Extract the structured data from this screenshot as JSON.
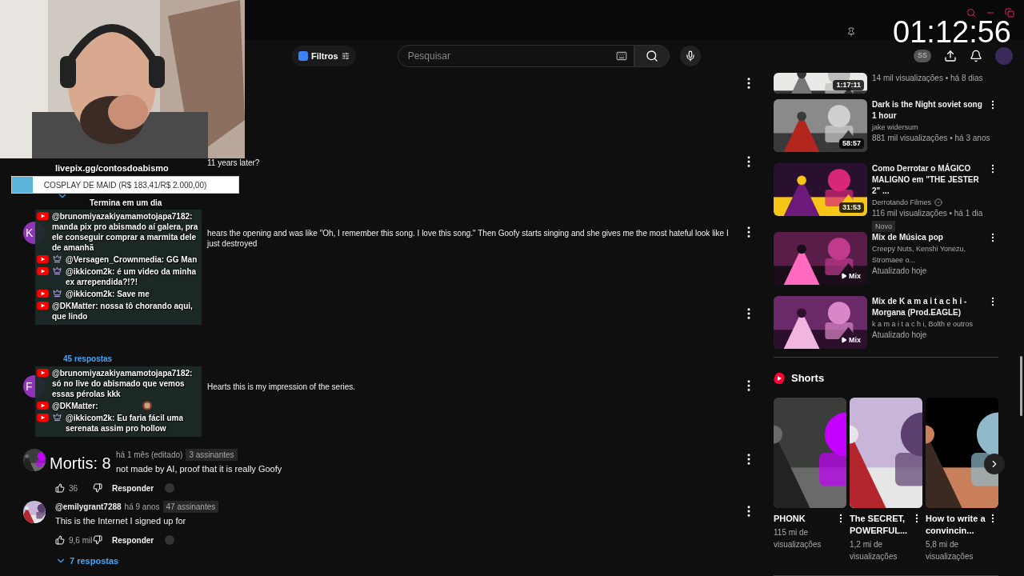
{
  "header": {
    "filter_chip": "Filtros",
    "search": {
      "placeholder": "Pesquisar"
    },
    "account_chip": "SS"
  },
  "comments": [
    {
      "kind": "covered"
    },
    {
      "kind": "partial",
      "text": "11 years later?",
      "replies_toggle": true
    },
    {
      "kind": "partial",
      "avatar_letter": "K",
      "text": "hears the opening and was like \"Oh, I remember this song. I love this song.\" Then Goofy starts singing and she gives me the most hateful look like I just destroyed"
    },
    {
      "kind": "covered",
      "replies": "45 respostas"
    },
    {
      "kind": "partial",
      "avatar_letter": "F",
      "text": "Hearts this is my impression of the series."
    },
    {
      "kind": "full",
      "time": "há 1 mês (editado)",
      "subscribers": "3 assinantes",
      "text": "not made by AI, proof that it is really Goofy",
      "likes": "36",
      "reply": "Responder"
    },
    {
      "kind": "full",
      "author": "@emilygrant7288",
      "time": "há 9 anos",
      "subscribers": "47 assinantes",
      "text": "This is the Internet I signed up for",
      "likes": "9,6 mil",
      "reply": "Responder",
      "replies": "7 respostas"
    }
  ],
  "sidebar": {
    "videos": [
      {
        "kind": "partial",
        "meta": "14 mil visualizações • há 8 dias",
        "duration": "1:17:11"
      },
      {
        "kind": "video",
        "title": "Dark is the Night soviet song 1 hour",
        "channel": "jake widersum",
        "verified": false,
        "meta": "881 mil visualizações • há 3 anos",
        "duration": "58:57"
      },
      {
        "kind": "video",
        "title": "Como Derrotar o MÁGICO MALIGNO em \"THE JESTER 2\" ...",
        "channel": "Derrotando Filmes",
        "verified": true,
        "meta": "116 mil visualizações • há 1 dia",
        "badge": "Novo",
        "duration": "31:53"
      },
      {
        "kind": "mix",
        "title": "Mix de Música pop",
        "channel": "Creepy Nuts, Kenshi Yonezu, Stromaee o...",
        "meta": "Atualizado hoje",
        "mix_label": "Mix"
      },
      {
        "kind": "mix",
        "title": "Mix de K a m a i t a c h i - Morgana (Prod.EAGLE)",
        "channel": "k a m a i t a c h i, Bolth e outros",
        "meta": "Atualizado hoje",
        "mix_label": "Mix"
      }
    ],
    "shorts": {
      "title": "Shorts",
      "items": [
        {
          "title": "PHONK",
          "views": "115 mi de visualizações"
        },
        {
          "title": "The SECRET, POWERFUL...",
          "views": "1,2 mi de visualizações"
        },
        {
          "title": "How to write a convincin...",
          "views": "5,8 mi de visualizações"
        }
      ]
    }
  },
  "stream_overlay": {
    "goal_link": "livepix.gg/contosdoabismo",
    "goal": {
      "label": "COSPLAY DE MAID (R$ 183,41/R$ 2.000,00)",
      "level": 0.092
    },
    "goal_ends": "Termina em um dia",
    "timer": "01:12:56",
    "counter": "Mortis: 8",
    "chat_panels": [
      {
        "messages": [
          {
            "author": "@brunomiyazakiyamamotojapa7182:",
            "text": "manda pix pro abismado aí galera, pra ele conseguir comprar a marmita dele de amanhã",
            "badge": false
          },
          {
            "author": "@Versagen_Crownmedia:",
            "text": "GG Man",
            "badge": true
          },
          {
            "author": "@ikkicom2k:",
            "text": "é um video da minha ex arrependida?!?!",
            "badge": true
          },
          {
            "author": "@ikkicom2k:",
            "text": "Save me",
            "badge": true
          },
          {
            "author": "@DKMatter:",
            "text": "nossa tô chorando aqui, que lindo",
            "badge": false
          }
        ]
      },
      {
        "messages": [
          {
            "author": "@brunomiyazakiyamamotojapa7182:",
            "text": "só no live do abismado que vemos essas pérolas kkk",
            "badge": false
          },
          {
            "author": "@DKMatter:",
            "emote": true,
            "badge": false
          },
          {
            "author": "@ikkicom2k:",
            "text": "Eu faria fácil uma serenata assim pro hollow",
            "badge": true
          }
        ]
      }
    ]
  }
}
